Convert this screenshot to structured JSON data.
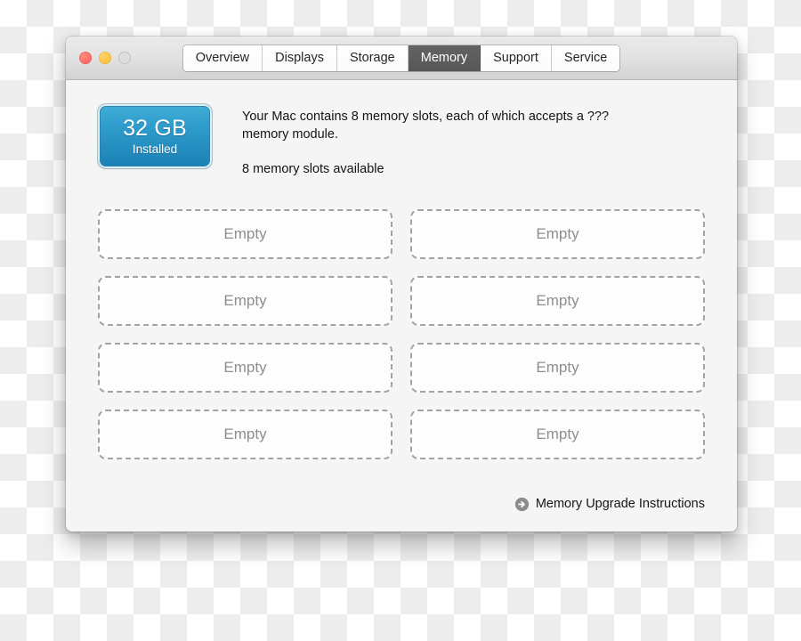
{
  "window": {
    "traffic_lights": [
      {
        "name": "close",
        "color": "#f85a52",
        "enabled": true
      },
      {
        "name": "minimize",
        "color": "#f9bc25",
        "enabled": true
      },
      {
        "name": "zoom",
        "color": "#dedede",
        "enabled": false
      }
    ],
    "tabs": [
      {
        "label": "Overview",
        "active": false
      },
      {
        "label": "Displays",
        "active": false
      },
      {
        "label": "Storage",
        "active": false
      },
      {
        "label": "Memory",
        "active": true
      },
      {
        "label": "Support",
        "active": false
      },
      {
        "label": "Service",
        "active": false
      }
    ]
  },
  "memory": {
    "badge": {
      "size": "32 GB",
      "state": "Installed",
      "accent_color": "#2e9ccc"
    },
    "description": "Your Mac contains 8 memory slots, each of which accepts a ??? memory module.",
    "slots_available": "8 memory slots available",
    "slots": [
      {
        "label": "Empty"
      },
      {
        "label": "Empty"
      },
      {
        "label": "Empty"
      },
      {
        "label": "Empty"
      },
      {
        "label": "Empty"
      },
      {
        "label": "Empty"
      },
      {
        "label": "Empty"
      },
      {
        "label": "Empty"
      }
    ]
  },
  "footer": {
    "icon": "arrow-right-circle-icon",
    "link_label": "Memory Upgrade Instructions"
  }
}
